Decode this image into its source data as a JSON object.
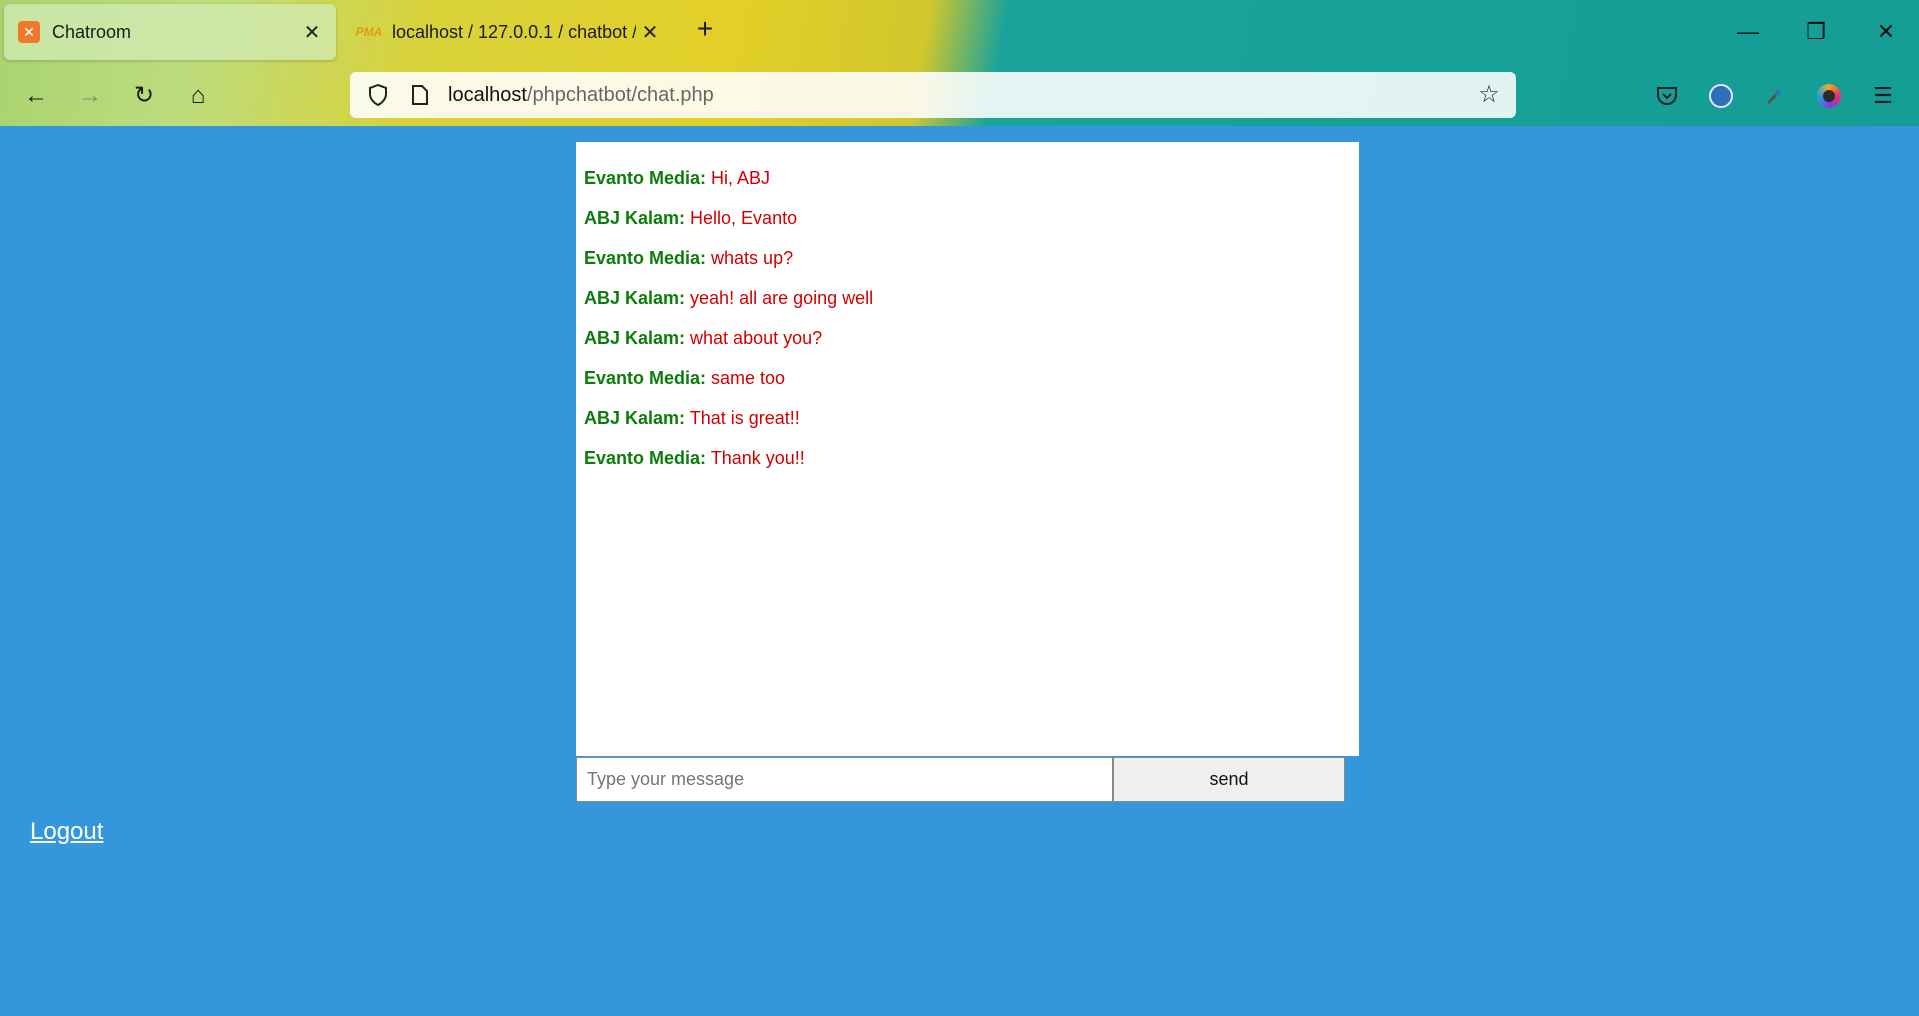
{
  "browser": {
    "tabs": [
      {
        "title": "Chatroom",
        "favicon": "xampp-icon",
        "active": true
      },
      {
        "title": "localhost / 127.0.0.1 / chatbot / ",
        "favicon": "phpmyadmin-icon",
        "favicon_text": "PMA",
        "active": false
      }
    ],
    "url_host": "localhost",
    "url_path": "/phpchatbot/chat.php"
  },
  "chat": {
    "messages": [
      {
        "sender": "Evanto Media:",
        "text": " Hi, ABJ"
      },
      {
        "sender": "ABJ Kalam:",
        "text": " Hello, Evanto"
      },
      {
        "sender": "Evanto Media:",
        "text": " whats up?"
      },
      {
        "sender": "ABJ Kalam:",
        "text": " yeah! all are going well"
      },
      {
        "sender": "ABJ Kalam:",
        "text": " what about you?"
      },
      {
        "sender": "Evanto Media:",
        "text": " same too"
      },
      {
        "sender": "ABJ Kalam:",
        "text": " That is great!!"
      },
      {
        "sender": "Evanto Media:",
        "text": " Thank you!!"
      }
    ],
    "input_placeholder": "Type your message",
    "input_value": "",
    "send_label": "send"
  },
  "logout_label": "Logout",
  "colors": {
    "page_background": "#3597db",
    "sender_name": "#0b7d0b",
    "message_text": "#d40000"
  }
}
